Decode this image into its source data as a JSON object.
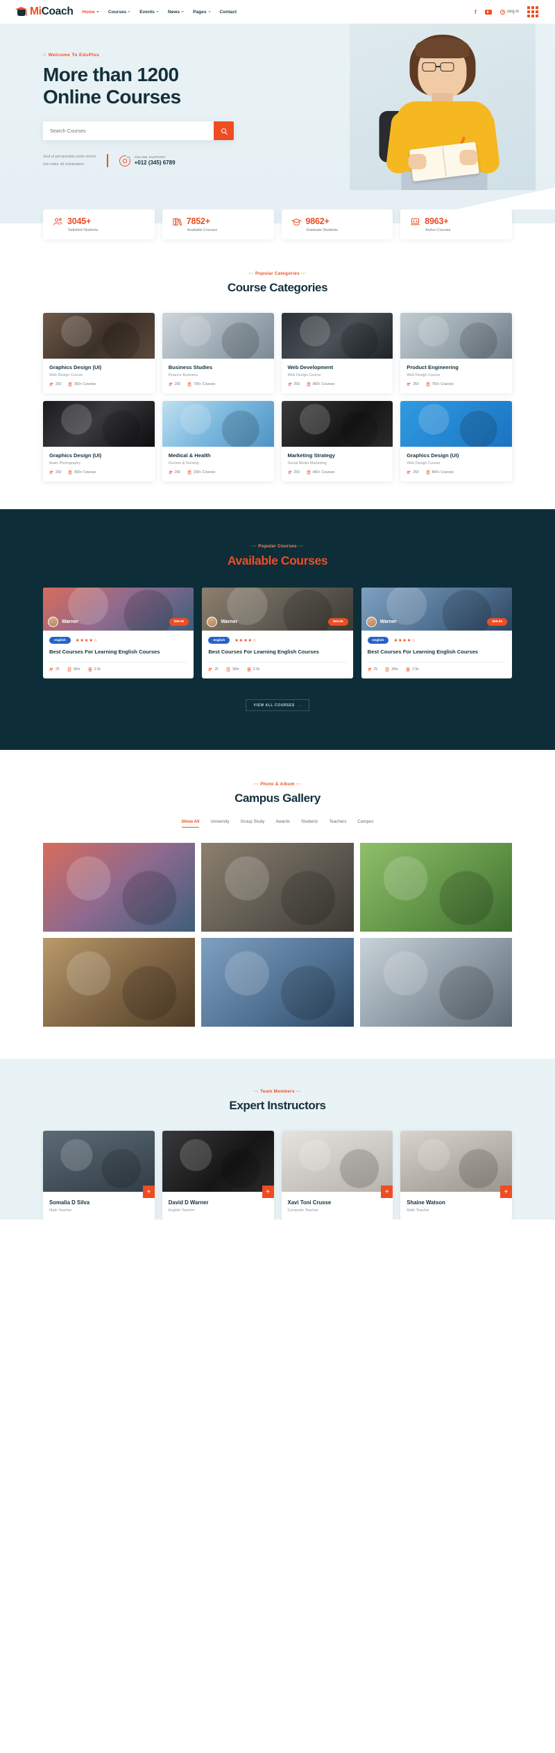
{
  "header": {
    "brand_mi": "Mi",
    "brand_coach": "Coach",
    "nav": [
      {
        "label": "Home",
        "has_caret": true,
        "active": true
      },
      {
        "label": "Courses",
        "has_caret": true,
        "active": false
      },
      {
        "label": "Events",
        "has_caret": true,
        "active": false
      },
      {
        "label": "News",
        "has_caret": true,
        "active": false
      },
      {
        "label": "Pages",
        "has_caret": true,
        "active": false
      },
      {
        "label": "Contact",
        "has_caret": false,
        "active": false
      }
    ],
    "facebook": "f",
    "signin_label": "sing in"
  },
  "hero": {
    "eyebrow": "Welcome To EduPlus",
    "title_line1": "More than 1200",
    "title_line2": "Online Courses",
    "search_placeholder": "Search Courses",
    "search_value": "",
    "lorem_line1": "Sed ut perspiciatis unde omnis",
    "lorem_line2": "iste natur sit voluptatem",
    "support_label": "ONLINE SUPPORT",
    "support_phone": "+012 (345) 6789"
  },
  "stats": [
    {
      "number": "3045+",
      "label": "Satisfied Students",
      "icon": "users-icon"
    },
    {
      "number": "7852+",
      "label": "Available Courses",
      "icon": "books-icon"
    },
    {
      "number": "9862+",
      "label": "Graduate Students",
      "icon": "graduation-cap-icon"
    },
    {
      "number": "8963+",
      "label": "Active Courses",
      "icon": "laptop-code-icon"
    }
  ],
  "categories_section": {
    "eyebrow": "Popular Categories",
    "title": "Course Categories",
    "items": [
      {
        "name": "Graphics Design (UI)",
        "sub": "Web Design Course",
        "students": "250",
        "courses": "800+ Courses"
      },
      {
        "name": "Business Studies",
        "sub": "Finance Business",
        "students": "250",
        "courses": "700+ Courses"
      },
      {
        "name": "Web Development",
        "sub": "Web Design Course",
        "students": "250",
        "courses": "800+ Courses"
      },
      {
        "name": "Product Engineering",
        "sub": "Web Design Course",
        "students": "250",
        "courses": "750+ Courses"
      },
      {
        "name": "Graphics Design (UI)",
        "sub": "Basic Photography",
        "students": "250",
        "courses": "800+ Courses"
      },
      {
        "name": "Medical & Health",
        "sub": "Doctors & Nursing",
        "students": "250",
        "courses": "200+ Courses"
      },
      {
        "name": "Marketing Strategy",
        "sub": "Social Media Marketing",
        "students": "250",
        "courses": "850+ Courses"
      },
      {
        "name": "Graphics Design (UI)",
        "sub": "Web Design Course",
        "students": "250",
        "courses": "800+ Courses"
      }
    ]
  },
  "available_section": {
    "eyebrow": "Popular Courses",
    "title": "Available Courses",
    "view_all": "VIEW ALL COURSES",
    "courses": [
      {
        "instructor": "Warner",
        "price": "$59.95",
        "tag": "english",
        "stars": "★★★★☆",
        "title": "Best Courses For Learning English Courses",
        "students": "25",
        "hours": "36hr",
        "views": "2.5k"
      },
      {
        "instructor": "Warner",
        "price": "$59.95",
        "tag": "english",
        "stars": "★★★★☆",
        "title": "Best Courses For Learning English Courses",
        "students": "25",
        "hours": "36hr",
        "views": "2.5k"
      },
      {
        "instructor": "Warner",
        "price": "$59.95",
        "tag": "english",
        "stars": "★★★★☆",
        "title": "Best Courses For Learning English Courses",
        "students": "25",
        "hours": "36hr",
        "views": "2.5k"
      }
    ]
  },
  "gallery_section": {
    "eyebrow": "Photo & Album",
    "title": "Campus Gallery",
    "filters": [
      {
        "label": "Show All",
        "active": true
      },
      {
        "label": "University",
        "active": false
      },
      {
        "label": "Group Study",
        "active": false
      },
      {
        "label": "Awards",
        "active": false
      },
      {
        "label": "Students",
        "active": false
      },
      {
        "label": "Teachers",
        "active": false
      },
      {
        "label": "Campus",
        "active": false
      }
    ]
  },
  "instructors_section": {
    "eyebrow": "Team Members",
    "title": "Expert Instructors",
    "items": [
      {
        "name": "Somalia D Silva",
        "role": "Math Teacher"
      },
      {
        "name": "David D Warner",
        "role": "English Teacher"
      },
      {
        "name": "Xavi Toni Crusse",
        "role": "Computer Teacher"
      },
      {
        "name": "Shaine Watson",
        "role": "Math Teacher"
      }
    ]
  },
  "colors": {
    "accent": "#ee4d23",
    "dark": "#0d2e38",
    "light_bg": "#e9f2f5",
    "tag_blue": "#2563c9"
  }
}
